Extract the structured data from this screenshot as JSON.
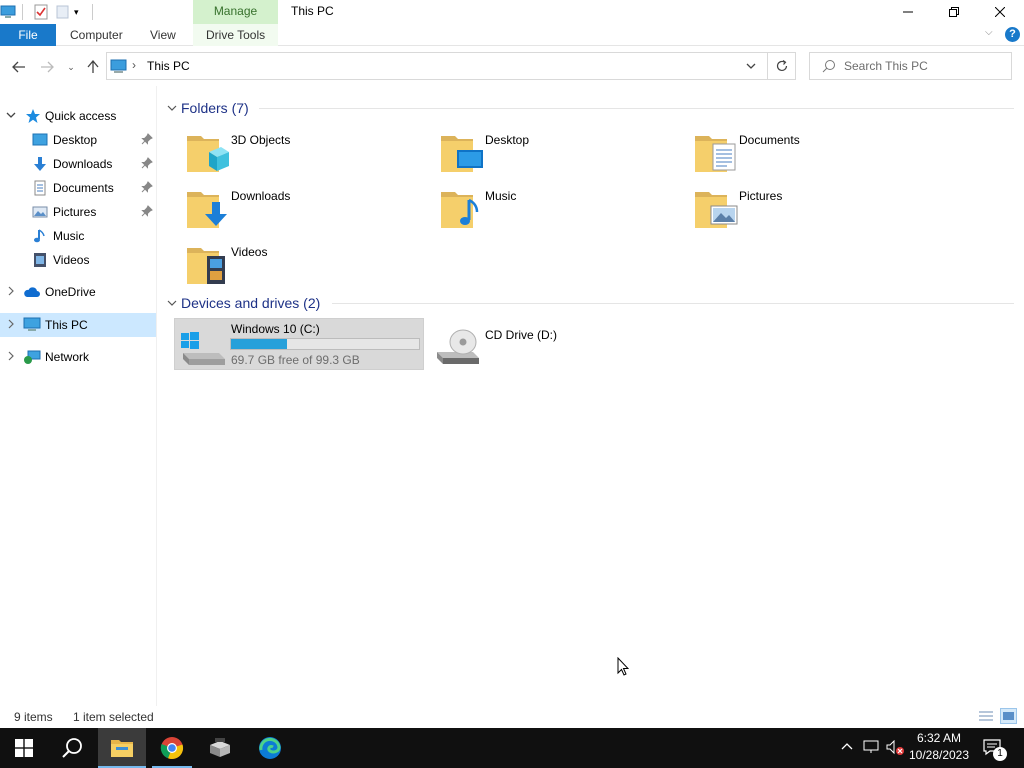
{
  "window": {
    "title": "This PC",
    "contextual_tab": "Manage",
    "minimize": "—",
    "restore": "❐",
    "close": "✕"
  },
  "ribbon": {
    "file": "File",
    "tabs": [
      "Computer",
      "View",
      "Drive Tools"
    ]
  },
  "address": {
    "separator": "›",
    "location": "This PC",
    "search_placeholder": "Search This PC"
  },
  "nav": {
    "quick_access": "Quick access",
    "quick_items": [
      "Desktop",
      "Downloads",
      "Documents",
      "Pictures",
      "Music",
      "Videos"
    ],
    "onedrive": "OneDrive",
    "this_pc": "This PC",
    "network": "Network"
  },
  "content": {
    "folders_header": "Folders (7)",
    "folders": [
      "3D Objects",
      "Desktop",
      "Documents",
      "Downloads",
      "Music",
      "Pictures",
      "Videos"
    ],
    "drives_header": "Devices and drives (2)",
    "drives": [
      {
        "name": "Windows 10 (C:)",
        "free": "69.7 GB free of 99.3 GB",
        "used_fraction": 0.3
      },
      {
        "name": "CD Drive (D:)"
      }
    ]
  },
  "status": {
    "items": "9 items",
    "selected": "1 item selected"
  },
  "taskbar": {
    "time": "6:32 AM",
    "date": "10/28/2023",
    "notifications": "1"
  },
  "colors": {
    "accent": "#1979ca",
    "selection": "#cce8ff",
    "header_text": "#1e3287",
    "drive_bar": "#26a0da",
    "taskbar": "#101010"
  }
}
